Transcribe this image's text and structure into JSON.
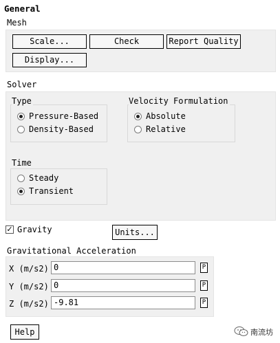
{
  "panel": {
    "title": "General"
  },
  "mesh": {
    "label": "Mesh",
    "buttons": {
      "scale": "Scale...",
      "check": "Check",
      "report_quality": "Report Quality",
      "display": "Display..."
    }
  },
  "solver": {
    "label": "Solver",
    "type": {
      "label": "Type",
      "options": [
        "Pressure-Based",
        "Density-Based"
      ],
      "selected": "Pressure-Based"
    },
    "velocity": {
      "label": "Velocity Formulation",
      "options": [
        "Absolute",
        "Relative"
      ],
      "selected": "Absolute"
    },
    "time": {
      "label": "Time",
      "options": [
        "Steady",
        "Transient"
      ],
      "selected": "Transient"
    }
  },
  "gravity": {
    "label": "Gravity",
    "checked": true,
    "checkmark": "✓",
    "units_button": "Units..."
  },
  "grav_accel": {
    "label": "Gravitational Acceleration",
    "rows": [
      {
        "label": "X (m/s2)",
        "value": "0",
        "p": "P"
      },
      {
        "label": "Y (m/s2)",
        "value": "0",
        "p": "P"
      },
      {
        "label": "Z (m/s2)",
        "value": "-9.81",
        "p": "P"
      }
    ]
  },
  "help_button": "Help",
  "watermark": {
    "text": "南流坊",
    "icon": "wechat-icon"
  }
}
